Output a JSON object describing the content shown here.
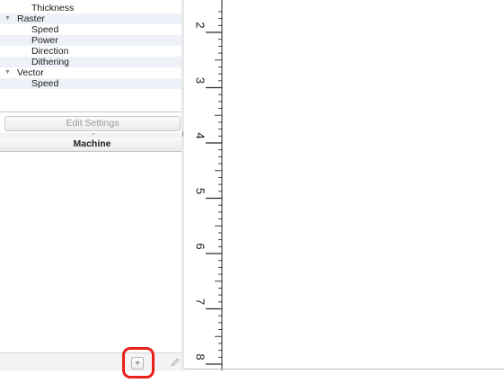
{
  "settings_tree": {
    "rows": [
      {
        "label": "Thickness",
        "level": 1
      },
      {
        "label": "Raster",
        "level": 0,
        "expanded": true
      },
      {
        "label": "Speed",
        "level": 1
      },
      {
        "label": "Power",
        "level": 1
      },
      {
        "label": "Direction",
        "level": 1
      },
      {
        "label": "Dithering",
        "level": 1
      },
      {
        "label": "Vector",
        "level": 0,
        "expanded": true
      },
      {
        "label": "Speed",
        "level": 1
      }
    ]
  },
  "edit_settings_label": "Edit Settings",
  "machine_panel": {
    "header": "Machine",
    "add_label": "+",
    "highlight_color": "#e8211b"
  },
  "ruler": {
    "orientation": "vertical",
    "labels": [
      "2",
      "3",
      "4",
      "5",
      "6",
      "7",
      "8"
    ]
  },
  "icons": {
    "expand": "triangle-down-icon",
    "edit": "pencil-icon"
  }
}
